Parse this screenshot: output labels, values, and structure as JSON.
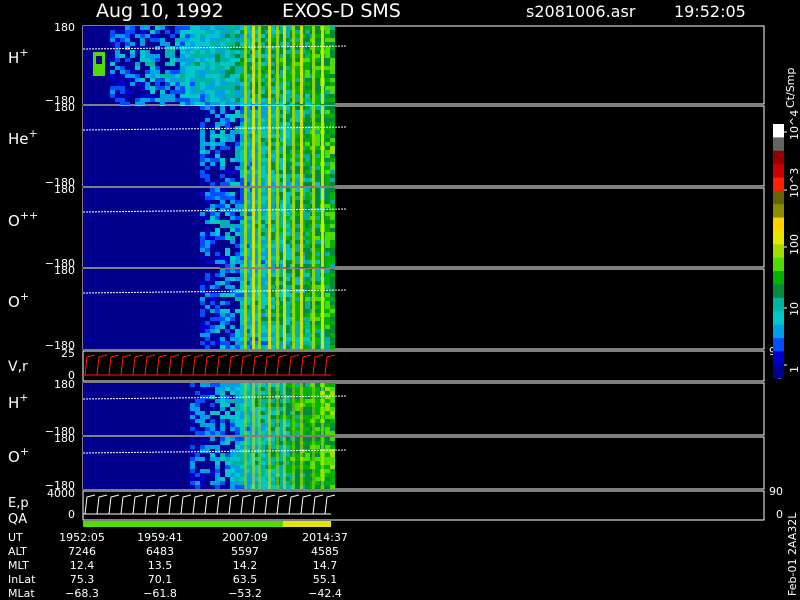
{
  "header": {
    "date": "Aug 10, 1992",
    "instrument": "EXOS-D SMS",
    "file": "s2081006.asr",
    "time": "19:52:05"
  },
  "chart_data": {
    "type": "heatmap",
    "title": "Aug 10, 1992   EXOS-D SMS",
    "colorbar": {
      "label": "Ct/Smp",
      "ticks": [
        "1",
        "10",
        "100",
        "10^3",
        "10^4"
      ],
      "colors": [
        "#00008c",
        "#0000c8",
        "#0050ff",
        "#00a0e6",
        "#00c8c8",
        "#00b4a0",
        "#008c3c",
        "#00b400",
        "#50dc00",
        "#a0dc00",
        "#e6e600",
        "#ffd200",
        "#8c8c00",
        "#646400",
        "#ff1e00",
        "#c80000",
        "#960000",
        "#646464",
        "#ffffff"
      ]
    },
    "panels": [
      {
        "species": "H",
        "charge": "+",
        "y_top": "180",
        "y_bottom": "−180",
        "ylim": [
          -180,
          180
        ]
      },
      {
        "species": "He",
        "charge": "+",
        "y_top": "180",
        "y_bottom": "−180",
        "ylim": [
          -180,
          180
        ]
      },
      {
        "species": "O",
        "charge": "++",
        "y_top": "180",
        "y_bottom": "−180",
        "ylim": [
          -180,
          180
        ]
      },
      {
        "species": "O",
        "charge": "+",
        "y_top": "180",
        "y_bottom": "−180",
        "ylim": [
          -180,
          180
        ]
      },
      {
        "type": "line",
        "label": "V,r",
        "y_top": "25",
        "y_zero": "0",
        "r_top": "90",
        "r_zero": "0"
      },
      {
        "species": "H",
        "charge": "+",
        "y_top": "180",
        "y_bottom": "−180",
        "ylim": [
          -180,
          180
        ]
      },
      {
        "species": "O",
        "charge": "+",
        "y_top": "180",
        "y_bottom": "−180",
        "ylim": [
          -180,
          180
        ]
      },
      {
        "type": "line",
        "label_top": "E,p",
        "label_bottom": "QA",
        "y_top": "4000",
        "y_zero": "0",
        "r_top": "90",
        "r_zero": "0"
      }
    ],
    "x_end_fraction": 0.364,
    "ephemeris": {
      "rows": [
        {
          "name": "UT",
          "values": [
            "1952:05",
            "1959:41",
            "2007:09",
            "2014:37"
          ]
        },
        {
          "name": "ALT",
          "values": [
            "7246",
            "6483",
            "5597",
            "4585"
          ]
        },
        {
          "name": "MLT",
          "values": [
            "12.4",
            "13.5",
            "14.2",
            "14.7"
          ]
        },
        {
          "name": "InLat",
          "values": [
            "75.3",
            "70.1",
            "63.5",
            "55.1"
          ]
        },
        {
          "name": "MLat",
          "values": [
            "−68.3",
            "−61.8",
            "−53.2",
            "−42.4"
          ]
        }
      ]
    },
    "footer_code": "Feb-01 2AA32L",
    "qa_colors": [
      "#50dc00",
      "#e6e600"
    ]
  }
}
